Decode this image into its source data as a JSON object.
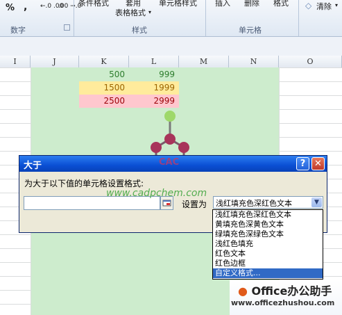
{
  "ribbon": {
    "number": {
      "percent": "%",
      "comma": ",",
      "inc_decimal": "←.0 .00",
      "dec_decimal": ".00 →.0",
      "group_label": "数字"
    },
    "styles": {
      "conditional_format": "条件格式",
      "format_as_table_top": "套用",
      "format_as_table": "表格格式",
      "cell_styles": "单元格样式",
      "group_label": "样式"
    },
    "cells": {
      "insert": "插入",
      "delete": "删除",
      "format": "格式",
      "group_label": "单元格"
    },
    "editing": {
      "clear": "清除"
    }
  },
  "columns": [
    "I",
    "J",
    "K",
    "L",
    "M",
    "N",
    "O"
  ],
  "sheet": {
    "rows": [
      {
        "k": "500",
        "l": "999"
      },
      {
        "k": "1500",
        "l": "1999"
      },
      {
        "k": "2500",
        "l": "2999"
      }
    ],
    "colors": {
      "green_text": "#2d7d2d",
      "yellow_fill": "#ffeb9c",
      "yellow_text": "#9c6500",
      "red_fill": "#ffc7ce",
      "red_text": "#9c0006",
      "range_fill": "#cdeccd"
    }
  },
  "dialog": {
    "title": "大于",
    "prompt": "为大于以下值的单元格设置格式:",
    "value": "",
    "set_as_label": "设置为",
    "selected_format": "浅红填充色深红色文本",
    "format_options": [
      "浅红填充色深红色文本",
      "黄填充色深黄色文本",
      "绿填充色深绿色文本",
      "浅红色填充",
      "红色文本",
      "红色边框",
      "自定义格式..."
    ]
  },
  "watermark": {
    "text": "www.cadpchem.com",
    "logo": "CAC"
  },
  "brand": {
    "name": "Office办公助手",
    "url": "www.officezhushou.com"
  }
}
